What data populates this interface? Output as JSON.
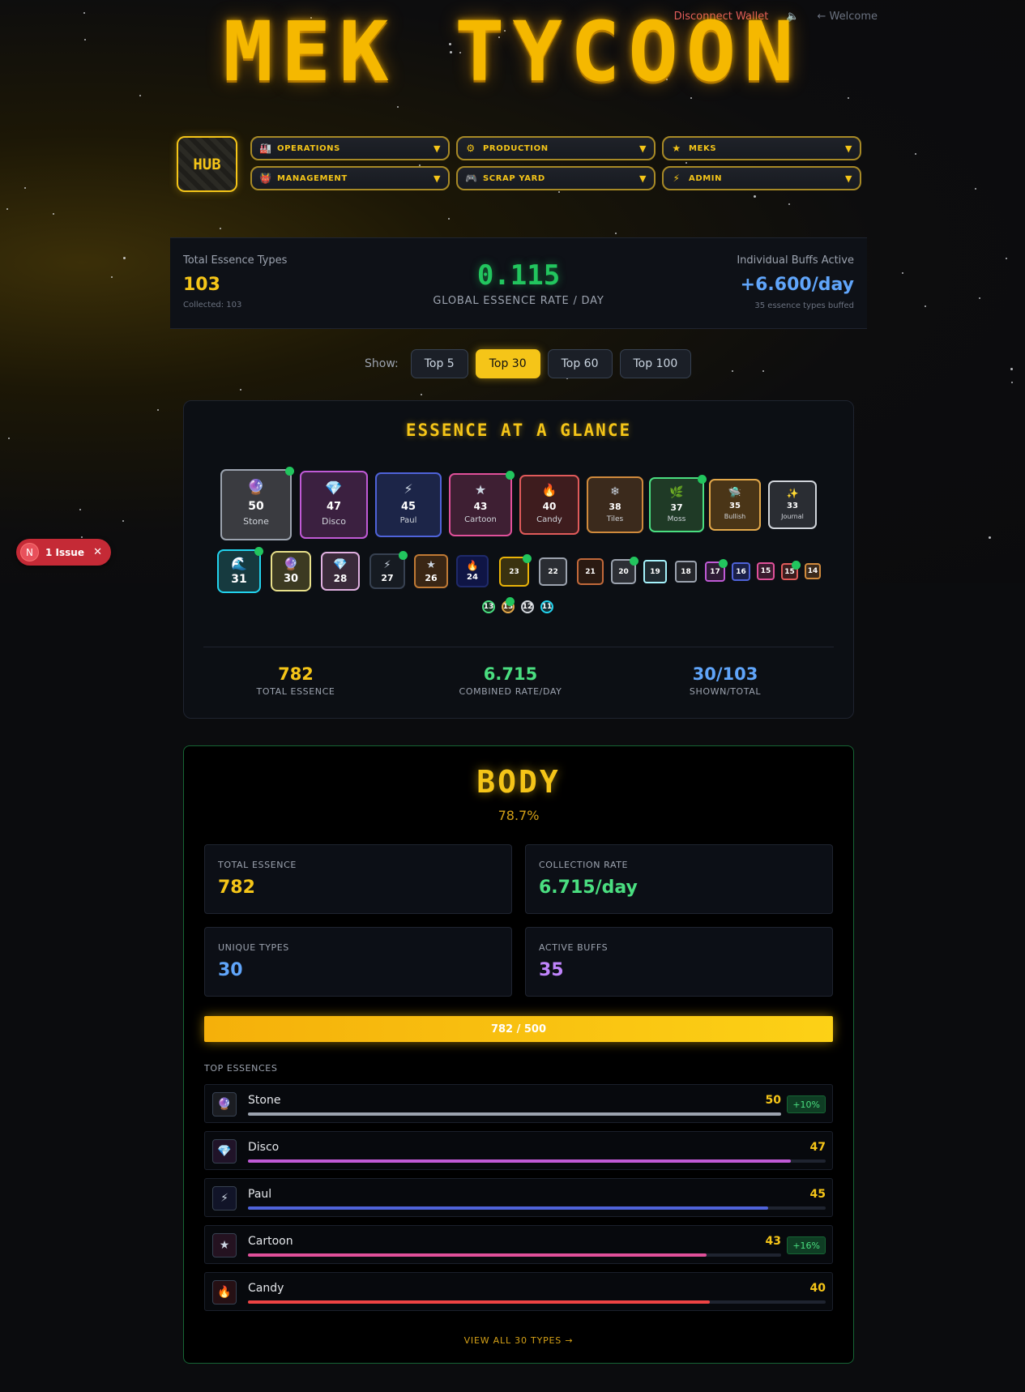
{
  "header": {
    "title": "MEK TYCOON",
    "disconnect": "Disconnect Wallet",
    "sound_icon": "speaker-icon",
    "welcome": "← Welcome"
  },
  "nav": {
    "hub": "HUB",
    "items": [
      {
        "label": "OPERATIONS",
        "icon": "🏭"
      },
      {
        "label": "PRODUCTION",
        "icon": "⚙"
      },
      {
        "label": "MEKS",
        "icon": "★"
      },
      {
        "label": "MANAGEMENT",
        "icon": "👹"
      },
      {
        "label": "SCRAP YARD",
        "icon": "🎮"
      },
      {
        "label": "ADMIN",
        "icon": "⚡"
      }
    ],
    "chevron": "▼"
  },
  "stats": {
    "left_label": "Total Essence Types",
    "left_value": "103",
    "left_sub": "Collected: 103",
    "center_value": "0.115",
    "center_label": "GLOBAL ESSENCE RATE / DAY",
    "right_label": "Individual Buffs Active",
    "right_value": "+6.600/day",
    "right_sub": "35 essence types buffed"
  },
  "filter": {
    "label": "Show:",
    "options": [
      "Top 5",
      "Top 30",
      "Top 60",
      "Top 100"
    ],
    "selected": "Top 30"
  },
  "glance": {
    "title": "ESSENCE AT A GLANCE",
    "row1": [
      {
        "value": "50",
        "name": "Stone",
        "icon": "🔮",
        "color": "#9ca3af",
        "bg": "#3a3b40",
        "dot": true
      },
      {
        "value": "47",
        "name": "Disco",
        "icon": "💎",
        "color": "#c05ad6",
        "bg": "#3b2040",
        "dot": false
      },
      {
        "value": "45",
        "name": "Paul",
        "icon": "⚡",
        "color": "#4f63d9",
        "bg": "#1c2548",
        "dot": false
      },
      {
        "value": "43",
        "name": "Cartoon",
        "icon": "★",
        "color": "#e0509a",
        "bg": "#3e1f33",
        "dot": true
      },
      {
        "value": "40",
        "name": "Candy",
        "icon": "🔥",
        "color": "#e05a5a",
        "bg": "#3e1c1e",
        "dot": false
      },
      {
        "value": "38",
        "name": "Tiles",
        "icon": "❄",
        "color": "#d08a3c",
        "bg": "#3b2a1c",
        "dot": false
      },
      {
        "value": "37",
        "name": "Moss",
        "icon": "🌿",
        "color": "#4ade80",
        "bg": "#1f3a26",
        "dot": true
      },
      {
        "value": "35",
        "name": "Bullish",
        "icon": "🛸",
        "color": "#e3a84a",
        "bg": "#4a3517",
        "dot": false
      },
      {
        "value": "33",
        "name": "Journal",
        "icon": "✨",
        "color": "#d1d5db",
        "bg": "#2a2d33",
        "dot": false
      }
    ],
    "row2": [
      {
        "value": "31",
        "icon": "🌊",
        "color": "#22d3ee",
        "bg": "#163a3f",
        "dot": true
      },
      {
        "value": "30",
        "icon": "🔮",
        "color": "#e8e08a",
        "bg": "#3c3a22",
        "dot": false
      },
      {
        "value": "28",
        "icon": "💎",
        "color": "#e0b0e0",
        "bg": "#3a2a3a",
        "dot": false
      },
      {
        "value": "27",
        "icon": "⚡",
        "color": "#374151",
        "bg": "#161b22",
        "dot": true
      },
      {
        "value": "26",
        "icon": "★",
        "color": "#c07a35",
        "bg": "#3a2614",
        "dot": false
      },
      {
        "value": "24",
        "icon": "🔥",
        "color": "#1f2a6b",
        "bg": "#0f1545",
        "dot": false
      },
      {
        "value": "23",
        "icon": "",
        "color": "#eab308",
        "bg": "#3a3210",
        "dot": true
      },
      {
        "value": "22",
        "icon": "",
        "color": "#9ca3af",
        "bg": "#2a2d33",
        "dot": false
      },
      {
        "value": "21",
        "icon": "",
        "color": "#c2693a",
        "bg": "#2a1a12",
        "dot": false
      },
      {
        "value": "20",
        "icon": "",
        "color": "#9ca3af",
        "bg": "#2d2f35",
        "dot": true
      },
      {
        "value": "19",
        "icon": "",
        "color": "#a5f3fc",
        "bg": "#1f2a30",
        "dot": false
      },
      {
        "value": "18",
        "icon": "",
        "color": "#9ca3af",
        "bg": "#24262b",
        "dot": false
      },
      {
        "value": "17",
        "icon": "",
        "color": "#c05ad6",
        "bg": "#2e1b35",
        "dot": true
      },
      {
        "value": "16",
        "icon": "",
        "color": "#4f63d9",
        "bg": "#1a2048",
        "dot": false
      },
      {
        "value": "15",
        "icon": "",
        "color": "#e0509a",
        "bg": "#3a1c2f",
        "dot": false
      },
      {
        "value": "15",
        "icon": "",
        "color": "#e05a5a",
        "bg": "#3a1c1e",
        "dot": true
      },
      {
        "value": "14",
        "icon": "",
        "color": "#d08a3c",
        "bg": "#3b2a1c",
        "dot": false
      }
    ],
    "row3": [
      {
        "value": "13",
        "color": "#4ade80",
        "bg": "#143020",
        "dot": false
      },
      {
        "value": "13",
        "color": "#e3a84a",
        "bg": "#4a3517",
        "dot": true
      },
      {
        "value": "12",
        "color": "#d1d5db",
        "bg": "#2a2d33",
        "dot": false
      },
      {
        "value": "11",
        "color": "#22d3ee",
        "bg": "#143038",
        "dot": false
      }
    ],
    "summary": [
      {
        "value": "782",
        "label": "TOTAL ESSENCE",
        "color": "#f5c518"
      },
      {
        "value": "6.715",
        "label": "COMBINED RATE/DAY",
        "color": "#4ade80"
      },
      {
        "value": "30/103",
        "label": "SHOWN/TOTAL",
        "color": "#60a5fa"
      }
    ]
  },
  "issue": {
    "badge": "N",
    "text": "1 Issue",
    "close": "✕"
  },
  "body": {
    "title": "BODY",
    "percent": "78.7%",
    "cards": [
      {
        "label": "TOTAL ESSENCE",
        "value": "782",
        "color": "#f5c518"
      },
      {
        "label": "COLLECTION RATE",
        "value": "6.715/day",
        "color": "#4ade80"
      },
      {
        "label": "UNIQUE TYPES",
        "value": "30",
        "color": "#60a5fa"
      },
      {
        "label": "ACTIVE BUFFS",
        "value": "35",
        "color": "#c084fc"
      }
    ],
    "progress_text": "782 / 500",
    "top_label": "TOP ESSENCES",
    "top": [
      {
        "name": "Stone",
        "value": "50",
        "icon": "🔮",
        "level": 1.0,
        "color": "#9ca3af",
        "badge": "+10%"
      },
      {
        "name": "Disco",
        "value": "47",
        "icon": "💎",
        "level": 0.94,
        "color": "#c05ad6",
        "badge": ""
      },
      {
        "name": "Paul",
        "value": "45",
        "icon": "⚡",
        "level": 0.9,
        "color": "#4f63d9",
        "badge": ""
      },
      {
        "name": "Cartoon",
        "value": "43",
        "icon": "★",
        "level": 0.86,
        "color": "#e0509a",
        "badge": "+16%"
      },
      {
        "name": "Candy",
        "value": "40",
        "icon": "🔥",
        "level": 0.8,
        "color": "#ef4444",
        "badge": ""
      }
    ],
    "view_all": "VIEW ALL 30 TYPES →"
  }
}
